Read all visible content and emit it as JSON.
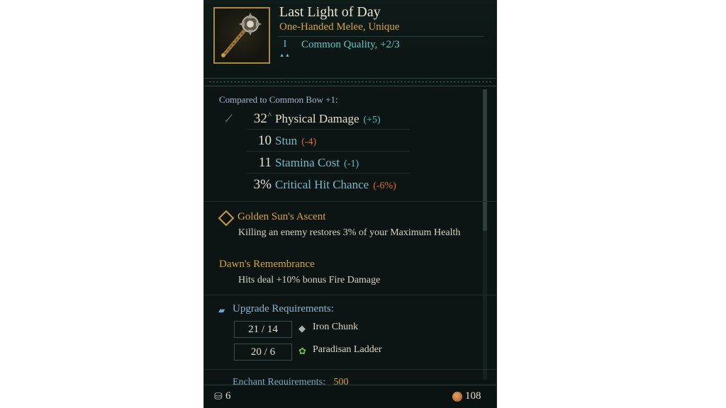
{
  "item": {
    "name": "Last Light of Day",
    "type": "One-Handed Melee, Unique",
    "tier": "I",
    "quality": "Common Quality, +2/3"
  },
  "comparison": {
    "label": "Compared to Common Bow +1:",
    "stats": [
      {
        "value": "32",
        "name": "Physical Damage",
        "delta": "(+5)",
        "delta_type": "pos"
      },
      {
        "value": "10",
        "name": "Stun",
        "delta": "(-4)",
        "delta_type": "neg"
      },
      {
        "value": "11",
        "name": "Stamina Cost",
        "delta": "(-1)",
        "delta_type": "pos"
      },
      {
        "value": "3%",
        "name": "Critical Hit Chance",
        "delta": "(-6%)",
        "delta_type": "neg"
      }
    ]
  },
  "perks": [
    {
      "title": "Golden Sun's Ascent",
      "text": "Killing an enemy restores 3% of your Maximum Health"
    },
    {
      "title": "Dawn's Remembrance",
      "text": "Hits deal +10% bonus Fire Damage"
    }
  ],
  "upgrade": {
    "title": "Upgrade Requirements:",
    "requirements": [
      {
        "amount": "21 / 14",
        "name": "Iron Chunk"
      },
      {
        "amount": "20 / 6",
        "name": "Paradisan Ladder"
      }
    ]
  },
  "enchant": {
    "label": "Enchant Requirements:",
    "cost": "500"
  },
  "footer": {
    "weight": "6",
    "price": "108"
  },
  "colors": {
    "accent_gold": "#d6a43e",
    "accent_teal": "#5fc8c4",
    "negative": "#e06a33"
  },
  "icons": {
    "weapon": "sword-icon",
    "anvil": "anvil-icon",
    "weight": "weight-icon",
    "coin": "coin-icon"
  }
}
